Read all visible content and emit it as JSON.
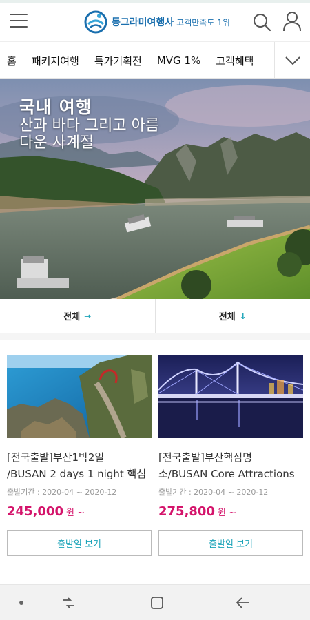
{
  "header": {
    "brand": "동그라미여행사",
    "brand_sub": "고객만족도 1위",
    "icons": [
      "hamburger-menu-icon",
      "search-icon",
      "user-icon"
    ]
  },
  "nav": {
    "items": [
      "홈",
      "패키지여행",
      "특가기획전",
      "MVG 1%",
      "고객혜택"
    ],
    "more_icon": "chevron-down-icon"
  },
  "banner": {
    "title": "국내 여행",
    "subtitle": "산과 바다 그리고 아름다운 사계절"
  },
  "filters": [
    {
      "label": "전체",
      "arrow": "→"
    },
    {
      "label": "전체",
      "arrow": "↓"
    }
  ],
  "products": [
    {
      "title_line1": "[전국출발]부산1박2일",
      "title_line2": "/BUSAN 2 days 1 night 핵심",
      "period": "출발기간 : 2020-04 ~ 2020-12",
      "price": "245,000",
      "price_unit": "원 ~",
      "button": "출발일 보기"
    },
    {
      "title_line1": "[전국출발]부산핵심명",
      "title_line2": "소/BUSAN Core Attractions",
      "period": "출발기간 : 2020-04 ~ 2020-12",
      "price": "275,800",
      "price_unit": "원 ~",
      "button": "출발일 보기"
    }
  ],
  "colors": {
    "brand_blue": "#1a6fae",
    "accent_teal": "#1aa3b8",
    "price_pink": "#d4146b"
  },
  "system_nav": [
    "dot-icon",
    "recent-apps-icon",
    "home-icon",
    "back-icon"
  ]
}
